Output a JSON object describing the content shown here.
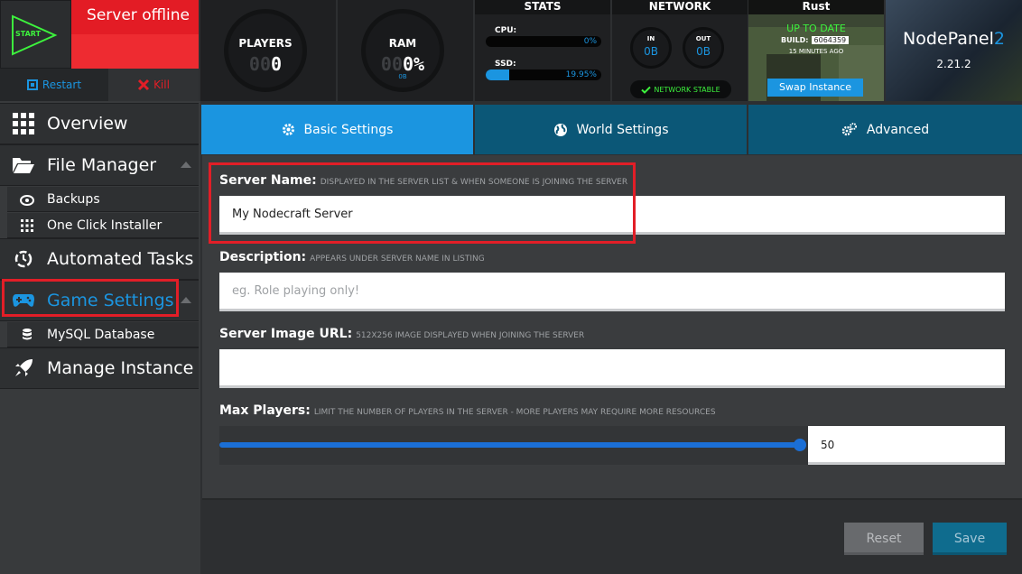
{
  "header": {
    "start_label": "START",
    "server_status": "Server offline",
    "restart_label": "Restart",
    "kill_label": "Kill"
  },
  "stats": {
    "players": {
      "title": "PLAYERS",
      "dim": "00",
      "value": "0"
    },
    "ram": {
      "title": "RAM",
      "dim": "00",
      "value": "0%",
      "sub": "0B"
    },
    "panel_title": "STATS",
    "cpu": {
      "label": "CPU:",
      "percent": "0%",
      "fill": 0
    },
    "ssd": {
      "label": "SSD:",
      "percent": "19.95%",
      "fill": 19.95
    },
    "network": {
      "title": "NETWORK",
      "in_label": "IN",
      "in_value": "0B",
      "out_label": "OUT",
      "out_value": "0B",
      "status": "NETWORK STABLE"
    }
  },
  "game": {
    "title": "Rust",
    "update_status": "UP TO DATE",
    "build_label": "BUILD:",
    "build_number": "6064359",
    "updated_ago": "15 MINUTES AGO",
    "swap_label": "Swap Instance"
  },
  "brand": {
    "name": "NodePanel",
    "name_suffix": "2",
    "version": "2.21.2"
  },
  "sidebar": {
    "overview": "Overview",
    "file_manager": "File Manager",
    "backups": "Backups",
    "one_click": "One Click Installer",
    "automated_tasks": "Automated Tasks",
    "game_settings": "Game Settings",
    "mysql": "MySQL Database",
    "manage_instance": "Manage Instance"
  },
  "tabs": {
    "basic": "Basic Settings",
    "world": "World Settings",
    "advanced": "Advanced"
  },
  "form": {
    "server_name": {
      "label": "Server Name:",
      "hint": "DISPLAYED IN THE SERVER LIST & WHEN SOMEONE IS JOINING THE SERVER",
      "value": "My Nodecraft Server"
    },
    "description": {
      "label": "Description:",
      "hint": "APPEARS UNDER SERVER NAME IN LISTING",
      "placeholder": "eg. Role playing only!"
    },
    "image_url": {
      "label": "Server Image URL:",
      "hint": "512X256 IMAGE DISPLAYED WHEN JOINING THE SERVER",
      "value": ""
    },
    "max_players": {
      "label": "Max Players:",
      "hint": "LIMIT THE NUMBER OF PLAYERS IN THE SERVER - MORE PLAYERS MAY REQUIRE MORE RESOURCES",
      "value": "50"
    }
  },
  "footer": {
    "reset_label": "Reset",
    "save_label": "Save"
  },
  "colors": {
    "accent": "#1b95e0",
    "danger": "#e21e27",
    "success": "#3df23d",
    "tab_inactive": "#0b5777"
  }
}
